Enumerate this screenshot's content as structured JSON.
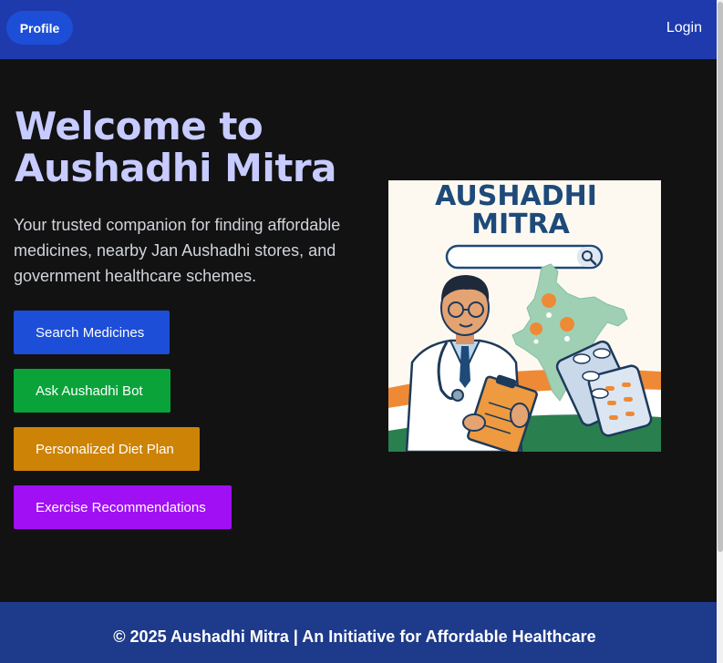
{
  "navbar": {
    "profile_label": "Profile",
    "login_label": "Login"
  },
  "hero": {
    "title_line1": "Welcome to",
    "title_line2": "Aushadhi Mitra",
    "description": "Your trusted companion for finding affordable medicines, nearby Jan Aushadhi stores, and government healthcare schemes.",
    "buttons": [
      {
        "label": "Search Medicines"
      },
      {
        "label": "Ask Aushadhi Bot"
      },
      {
        "label": "Personalized Diet Plan"
      },
      {
        "label": "Exercise Recommendations"
      }
    ],
    "image": {
      "title_line1": "AUSHADHI",
      "title_line2": "MITRA"
    }
  },
  "footer": {
    "copyright": "© 2025 Aushadhi Mitra | An Initiative for Affordable Healthcare"
  },
  "colors": {
    "navbar": "#1e3aad",
    "background": "#121212",
    "title": "#c7cbff",
    "search_button": "#1d4ed8",
    "bot_button": "#0aa33a",
    "diet_button": "#cc8306",
    "exercise_button": "#a10ff5",
    "footer": "#1e3a8a"
  }
}
